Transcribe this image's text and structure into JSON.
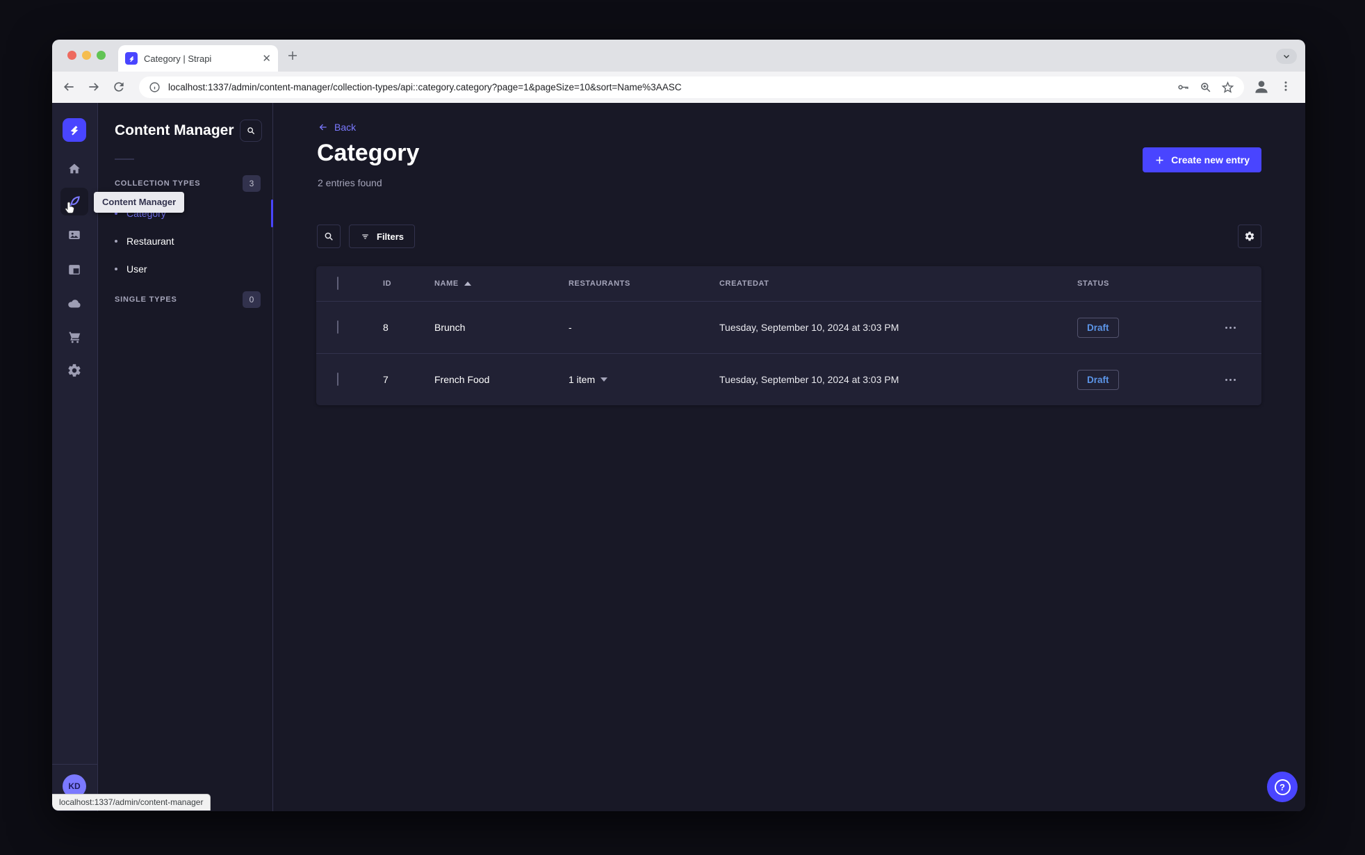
{
  "browser": {
    "tab_title": "Category | Strapi",
    "url": "localhost:1337/admin/content-manager/collection-types/api::category.category?page=1&pageSize=10&sort=Name%3AASC",
    "status_bar_text": "localhost:1337/admin/content-manager"
  },
  "colors": {
    "accent": "#4945ff",
    "accent_light": "#7b79ff",
    "app_background": "#181826",
    "surface": "#212134",
    "border": "#32324d",
    "muted_text": "#a5a5ba",
    "draft_text": "#5c95e8"
  },
  "nav_rail": {
    "items": [
      "home",
      "content-manager",
      "media-library",
      "content-type-builder",
      "cloud",
      "marketplace",
      "settings"
    ],
    "active_item": "content-manager",
    "tooltip_text": "Content Manager",
    "avatar_initials": "KD"
  },
  "subnav": {
    "title": "Content Manager",
    "collection_types": {
      "label": "COLLECTION TYPES",
      "badge": "3",
      "items": [
        "Category",
        "Restaurant",
        "User"
      ],
      "active_item": "Category"
    },
    "single_types": {
      "label": "SINGLE TYPES",
      "badge": "0"
    }
  },
  "main": {
    "back_label": "Back",
    "title": "Category",
    "entries_count": "2 entries found",
    "create_button_label": "Create new entry",
    "filters_button_label": "Filters",
    "table": {
      "columns": [
        "ID",
        "NAME",
        "RESTAURANTS",
        "CREATEDAT",
        "STATUS"
      ],
      "sorted_column": "NAME",
      "rows": [
        {
          "id": "8",
          "name": "Brunch",
          "restaurants": "-",
          "created_at": "Tuesday, September 10, 2024 at 3:03 PM",
          "status": "Draft"
        },
        {
          "id": "7",
          "name": "French Food",
          "restaurants": "1 item",
          "created_at": "Tuesday, September 10, 2024 at 3:03 PM",
          "status": "Draft"
        }
      ]
    }
  },
  "help_label": "?"
}
